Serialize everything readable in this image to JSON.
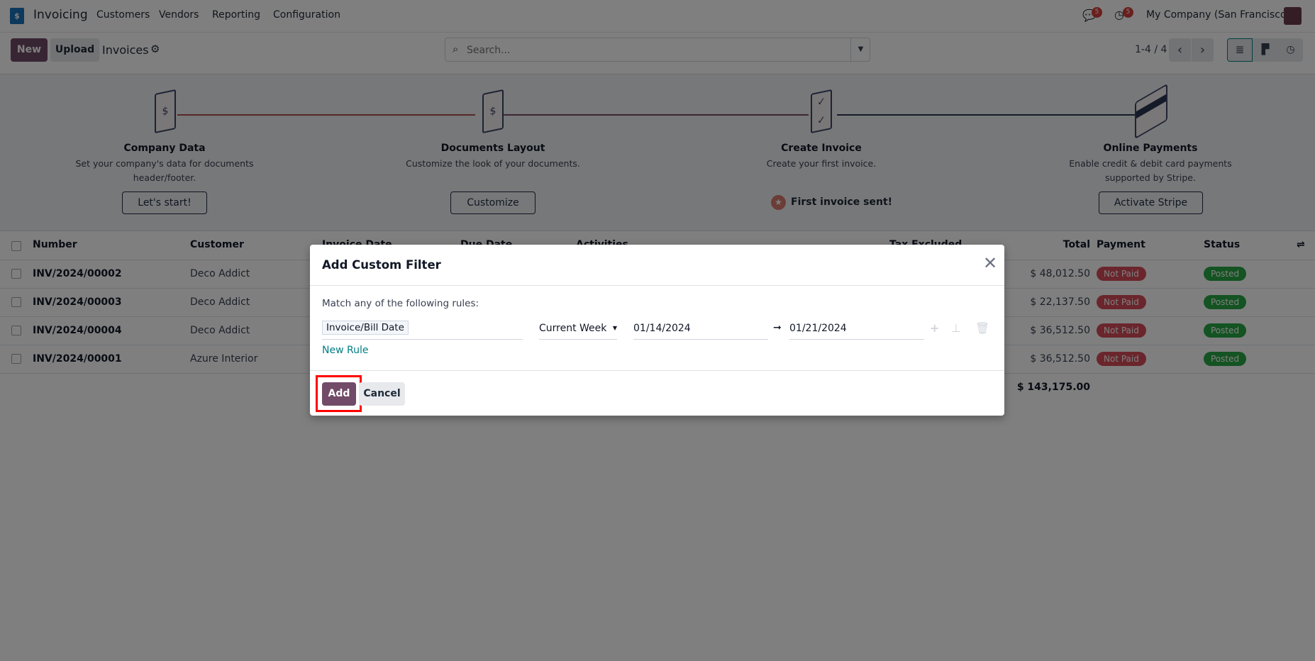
{
  "navbar": {
    "app_name": "Invoicing",
    "menu": [
      "Customers",
      "Vendors",
      "Reporting",
      "Configuration"
    ],
    "messages_count": "5",
    "activities_count": "5",
    "company": "My Company (San Francisco)"
  },
  "control": {
    "new_label": "New",
    "upload_label": "Upload",
    "title": "Invoices",
    "search_placeholder": "Search...",
    "pager": "1-4 / 4"
  },
  "onboarding": [
    {
      "title": "Company Data",
      "desc1": "Set your company's data for documents",
      "desc2": "header/footer.",
      "button": "Let's start!"
    },
    {
      "title": "Documents Layout",
      "desc1": "Customize the look of your documents.",
      "desc2": "",
      "button": "Customize"
    },
    {
      "title": "Create Invoice",
      "desc1": "Create your first invoice.",
      "desc2": "",
      "done": "First invoice sent!"
    },
    {
      "title": "Online Payments",
      "desc1": "Enable credit & debit card payments",
      "desc2": "supported by Stripe.",
      "button": "Activate Stripe"
    }
  ],
  "table": {
    "headers": [
      "Number",
      "Customer",
      "Invoice Date",
      "Due Date",
      "Activities",
      "Tax Excluded",
      "Total",
      "Payment",
      "Status"
    ],
    "rows": [
      {
        "number": "INV/2024/00002",
        "customer": "Deco Addict",
        "total": "$ 48,012.50",
        "payment": "Not Paid",
        "status": "Posted"
      },
      {
        "number": "INV/2024/00003",
        "customer": "Deco Addict",
        "total": "$ 22,137.50",
        "payment": "Not Paid",
        "status": "Posted"
      },
      {
        "number": "INV/2024/00004",
        "customer": "Deco Addict",
        "total": "$ 36,512.50",
        "payment": "Not Paid",
        "status": "Posted"
      },
      {
        "number": "INV/2024/00001",
        "customer": "Azure Interior",
        "total": "$ 36,512.50",
        "payment": "Not Paid",
        "status": "Posted"
      }
    ],
    "sum_total": "$ 143,175.00"
  },
  "dialog": {
    "title": "Add Custom Filter",
    "match_text": "Match any of the following rules:",
    "rule": {
      "field": "Invoice/Bill Date",
      "operator": "Current Week",
      "value_from": "01/14/2024",
      "value_to": "01/21/2024"
    },
    "new_rule": "New Rule",
    "add_label": "Add",
    "cancel_label": "Cancel"
  },
  "colors": {
    "primary": "#714B67",
    "not_paid": "#d44c59",
    "posted": "#28a745",
    "link": "#017e84",
    "highlight": "#ff0000"
  }
}
